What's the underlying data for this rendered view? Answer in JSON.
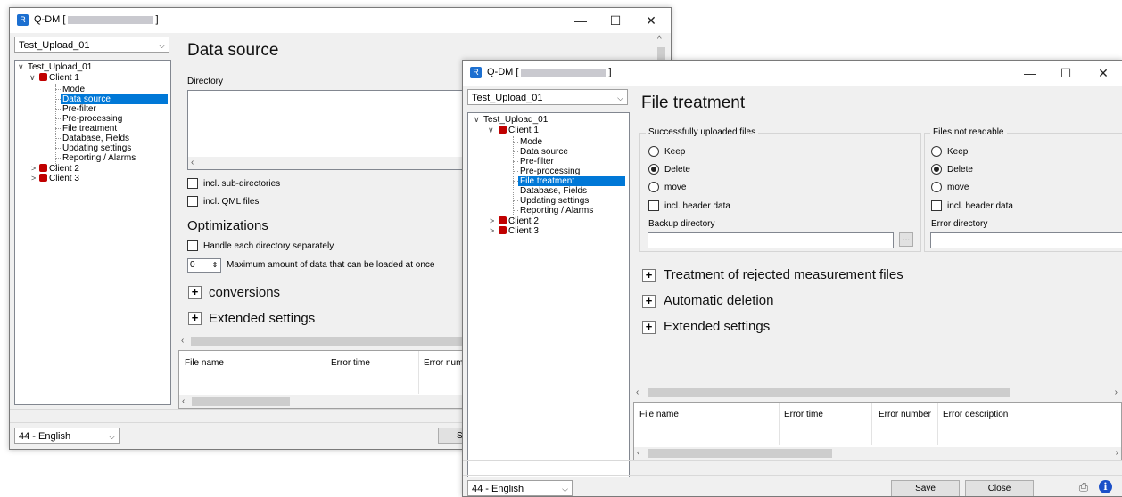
{
  "back_window": {
    "title_prefix": "Q-DM [",
    "title_suffix": "]",
    "controls": {
      "minimize": "—",
      "maximize": "☐",
      "close": "✕"
    },
    "project_select": "Test_Upload_01",
    "tree": {
      "root": "Test_Upload_01",
      "client1": "Client 1",
      "children": [
        "Mode",
        "Data source",
        "Pre-filter",
        "Pre-processing",
        "File treatment",
        "Database, Fields",
        "Updating settings",
        "Reporting / Alarms"
      ],
      "client2": "Client 2",
      "client3": "Client 3"
    },
    "heading": "Data source",
    "directory_label": "Directory",
    "incl_sub_directories": "incl. sub-directories",
    "incl_qml_files": "incl. QML files",
    "optimizations_heading": "Optimizations",
    "handle_each_directory": "Handle each directory separately",
    "max_amount_value": "0",
    "max_amount_label": "Maximum amount of data that can be loaded at once",
    "conversions": "conversions",
    "extended_settings": "Extended settings",
    "columns": [
      "File name",
      "Error time",
      "Error number"
    ],
    "language_select": "44 - English",
    "save_partial": "S"
  },
  "front_window": {
    "title_prefix": "Q-DM [",
    "title_suffix": "]",
    "controls": {
      "minimize": "—",
      "maximize": "☐",
      "close": "✕"
    },
    "project_select": "Test_Upload_01",
    "tree": {
      "root": "Test_Upload_01",
      "client1": "Client 1",
      "children": [
        "Mode",
        "Data source",
        "Pre-filter",
        "Pre-processing",
        "File treatment",
        "Database, Fields",
        "Updating settings",
        "Reporting / Alarms"
      ],
      "client2": "Client 2",
      "client3": "Client 3"
    },
    "heading": "File treatment",
    "uploaded_group": {
      "title": "Successfully uploaded files",
      "options": [
        "Keep",
        "Delete",
        "move"
      ],
      "selected": "Delete",
      "incl_header": "incl. header data",
      "backup_label": "Backup directory",
      "browse": "..."
    },
    "unreadable_group": {
      "title": "Files not readable",
      "options": [
        "Keep",
        "Delete",
        "move"
      ],
      "selected": "Delete",
      "incl_header": "incl. header data",
      "error_dir_label": "Error directory"
    },
    "sections": [
      "Treatment of rejected measurement files",
      "Automatic deletion",
      "Extended settings"
    ],
    "columns": [
      "File name",
      "Error time",
      "Error number",
      "Error description"
    ],
    "language_select": "44 - English",
    "save": "Save",
    "close": "Close"
  }
}
